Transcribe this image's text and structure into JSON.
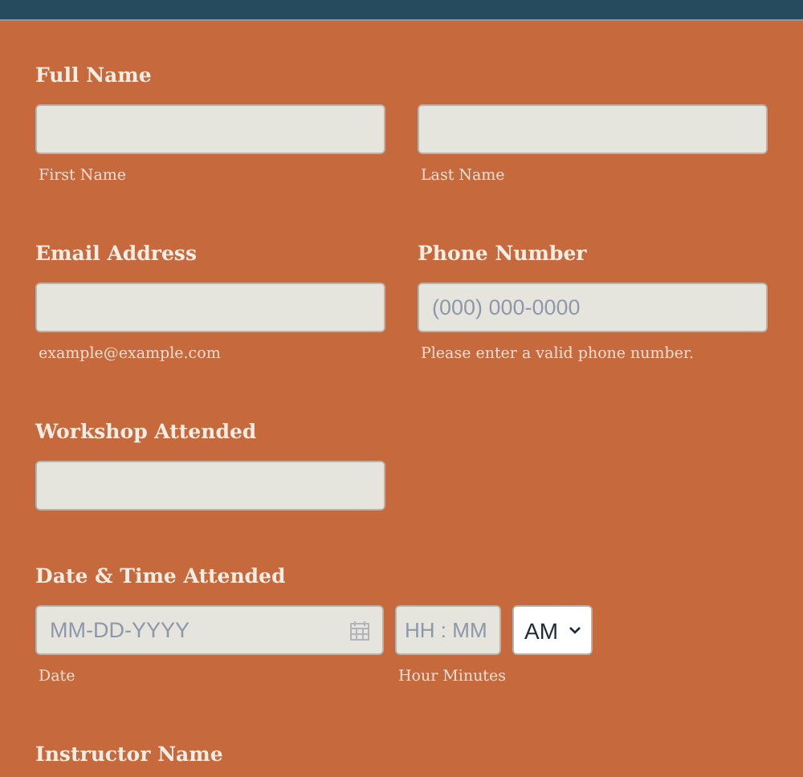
{
  "rows": [
    {
      "sections": [
        {
          "label": "Full Name",
          "fields": [
            {
              "kind": "text",
              "sublabel": "First Name"
            },
            {
              "kind": "text",
              "sublabel": "Last Name"
            }
          ]
        }
      ]
    },
    {
      "sections": [
        {
          "label": "Email Address",
          "fields": [
            {
              "kind": "text",
              "sublabel": "example@example.com"
            }
          ]
        },
        {
          "label": "Phone Number",
          "fields": [
            {
              "kind": "text",
              "placeholder": "(000) 000-0000",
              "sublabel": "Please enter a valid phone number."
            }
          ]
        }
      ]
    },
    {
      "sections": [
        {
          "label": "Workshop Attended",
          "fields": [
            {
              "kind": "text"
            }
          ]
        }
      ]
    },
    {
      "sections": [
        {
          "label": "Date & Time Attended",
          "fields": [
            {
              "kind": "date",
              "placeholder": "MM-DD-YYYY",
              "sublabel": "Date"
            },
            {
              "kind": "time",
              "placeholder": "HH : MM",
              "sublabel": "Hour Minutes"
            },
            {
              "kind": "select",
              "value": "AM"
            }
          ]
        }
      ]
    },
    {
      "sections": [
        {
          "label": "Instructor Name"
        }
      ]
    }
  ]
}
